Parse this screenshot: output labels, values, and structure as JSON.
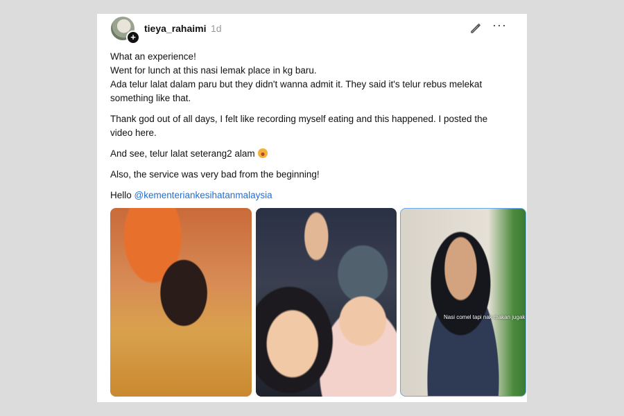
{
  "post": {
    "username": "tieya_rahaimi",
    "timeago": "1d",
    "avatar_badge": "+",
    "paragraphs": [
      "What an experience!\nWent for lunch at this nasi lemak place in kg baru.\nAda telur lalat dalam paru but they didn't wanna admit it. They said it's telur rebus melekat something like that.",
      "Thank god out of all days, I felt like recording myself eating and this happened. I posted the video here.",
      "And see, telur lalat seterang2 alam",
      "Also, the service was very bad from the beginning!"
    ],
    "hello_prefix": "Hello",
    "mention": "@kementeriankesihatanmalaysia",
    "emoji_icon": "pouting-face-emoji-icon",
    "photo_caption": "Nasi comel tapi nak makan jugak"
  },
  "icons": {
    "edit": "pencil-icon",
    "more": "more-options-icon",
    "more_glyph": "···"
  },
  "colors": {
    "mention": "#1d6fd6",
    "background": "#dcdcdc",
    "card": "#ffffff"
  }
}
